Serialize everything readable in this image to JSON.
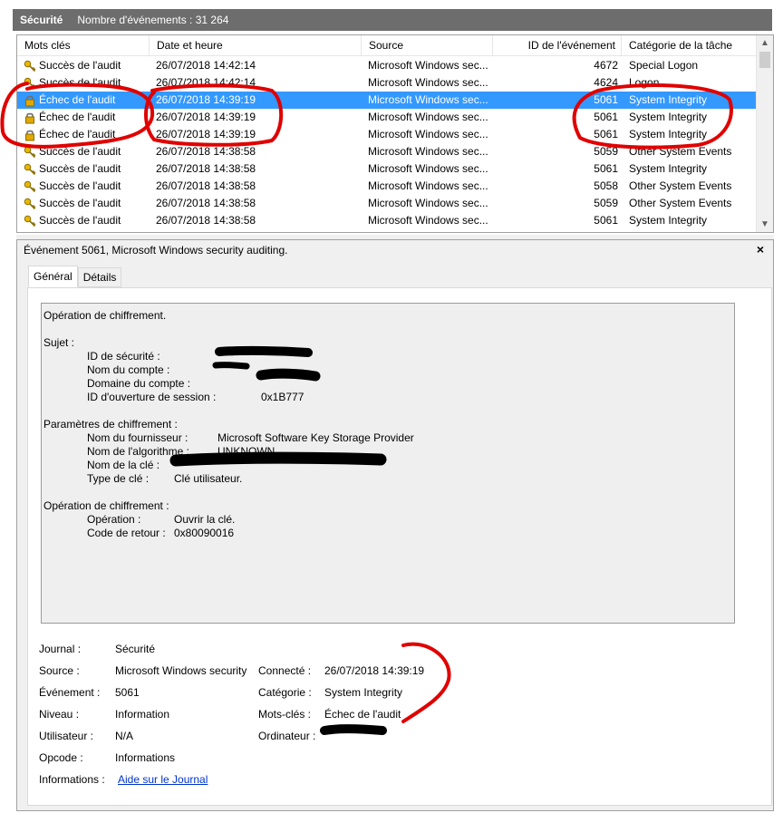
{
  "header": {
    "title": "Sécurité",
    "count_text": "Nombre d'événements : 31 264"
  },
  "columns": {
    "keywords": "Mots clés",
    "datetime": "Date et heure",
    "source": "Source",
    "event_id": "ID de l'événement",
    "category": "Catégorie de la tâche"
  },
  "rows": [
    {
      "kw": "Succès de l'audit",
      "icon": "key-icon",
      "dt": "26/07/2018 14:42:14",
      "src": "Microsoft Windows sec...",
      "id": "4672",
      "cat": "Special Logon",
      "selected": false
    },
    {
      "kw": "Succès de l'audit",
      "icon": "key-icon",
      "dt": "26/07/2018 14:42:14",
      "src": "Microsoft Windows sec...",
      "id": "4624",
      "cat": "Logon",
      "selected": false
    },
    {
      "kw": "Échec de l'audit",
      "icon": "lock-icon",
      "dt": "26/07/2018 14:39:19",
      "src": "Microsoft Windows sec...",
      "id": "5061",
      "cat": "System Integrity",
      "selected": true
    },
    {
      "kw": "Échec de l'audit",
      "icon": "lock-icon",
      "dt": "26/07/2018 14:39:19",
      "src": "Microsoft Windows sec...",
      "id": "5061",
      "cat": "System Integrity",
      "selected": false
    },
    {
      "kw": "Échec de l'audit",
      "icon": "lock-icon",
      "dt": "26/07/2018 14:39:19",
      "src": "Microsoft Windows sec...",
      "id": "5061",
      "cat": "System Integrity",
      "selected": false
    },
    {
      "kw": "Succès de l'audit",
      "icon": "key-icon",
      "dt": "26/07/2018 14:38:58",
      "src": "Microsoft Windows sec...",
      "id": "5059",
      "cat": "Other System Events",
      "selected": false
    },
    {
      "kw": "Succès de l'audit",
      "icon": "key-icon",
      "dt": "26/07/2018 14:38:58",
      "src": "Microsoft Windows sec...",
      "id": "5061",
      "cat": "System Integrity",
      "selected": false
    },
    {
      "kw": "Succès de l'audit",
      "icon": "key-icon",
      "dt": "26/07/2018 14:38:58",
      "src": "Microsoft Windows sec...",
      "id": "5058",
      "cat": "Other System Events",
      "selected": false
    },
    {
      "kw": "Succès de l'audit",
      "icon": "key-icon",
      "dt": "26/07/2018 14:38:58",
      "src": "Microsoft Windows sec...",
      "id": "5059",
      "cat": "Other System Events",
      "selected": false
    },
    {
      "kw": "Succès de l'audit",
      "icon": "key-icon",
      "dt": "26/07/2018 14:38:58",
      "src": "Microsoft Windows sec...",
      "id": "5061",
      "cat": "System Integrity",
      "selected": false
    }
  ],
  "detail": {
    "title": "Événement 5061, Microsoft Windows security auditing.",
    "close": "×",
    "tabs": [
      "Général",
      "Détails"
    ],
    "message": {
      "op_title": "Opération de chiffrement.",
      "subject": "Sujet :",
      "security_id_label": "ID de sécurité :",
      "account_name_label": "Nom du compte :",
      "account_domain_label": "Domaine du compte :",
      "logon_id_label": "ID d'ouverture de session :",
      "logon_id_value": "0x1B777",
      "crypto_params": "Paramètres de chiffrement :",
      "provider_label": "Nom du fournisseur :",
      "provider_value": "Microsoft Software Key Storage Provider",
      "algo_label": "Nom de l'algorithme :",
      "algo_value": "UNKNOWN",
      "key_name_label": "Nom de la clé :",
      "key_type_label": "Type de clé :",
      "key_type_value": "Clé utilisateur.",
      "crypto_op": "Opération de chiffrement :",
      "operation_label": "Opération :",
      "operation_value": "Ouvrir la clé.",
      "return_label": "Code de retour :",
      "return_value": "0x80090016"
    },
    "props": {
      "journal_label": "Journal :",
      "journal_value": "Sécurité",
      "source_label": "Source :",
      "source_value": "Microsoft Windows security",
      "connected_label": "Connecté :",
      "connected_value": "26/07/2018 14:39:19",
      "event_label": "Événement :",
      "event_value": "5061",
      "category_label": "Catégorie :",
      "category_value": "System Integrity",
      "level_label": "Niveau :",
      "level_value": "Information",
      "keywords_label": "Mots-clés :",
      "keywords_value": "Échec de l'audit",
      "user_label": "Utilisateur :",
      "user_value": "N/A",
      "computer_label": "Ordinateur :",
      "opcode_label": "Opcode :",
      "opcode_value": "Informations",
      "info_label": "Informations :",
      "info_link": "Aide sur le Journal"
    }
  },
  "colors": {
    "header_bg": "#6d6d6d",
    "selection": "#3399ff",
    "annotation": "#e00000",
    "redaction": "#000000"
  }
}
